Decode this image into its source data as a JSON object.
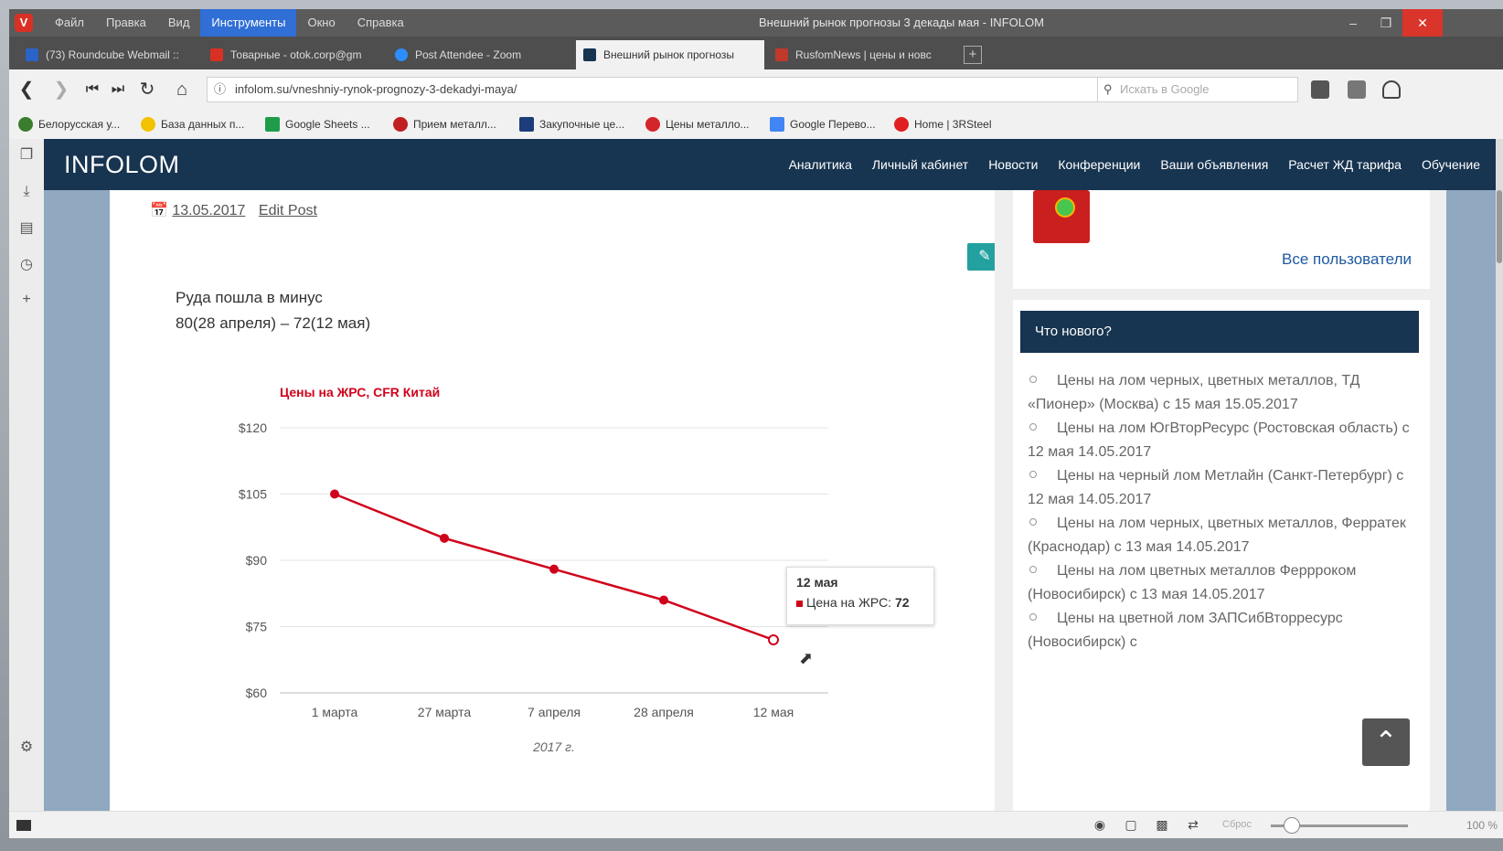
{
  "browser": {
    "menu": [
      "Файл",
      "Правка",
      "Вид",
      "Инструменты",
      "Окно",
      "Справка"
    ],
    "window_title": "Внешний рынок прогнозы 3 декады мая - INFOLOM",
    "tabs": [
      {
        "label": "(73) Roundcube Webmail ::",
        "icon_color": "#2b63c8"
      },
      {
        "label": "Товарные - otok.corp@gm",
        "icon_color": "#d93025"
      },
      {
        "label": "Post Attendee - Zoom",
        "icon_color": "#2d8cff"
      },
      {
        "label": "Внешний рынок прогнозы",
        "icon_color": "#173450"
      },
      {
        "label": "RusfomNews | цены и новс",
        "icon_color": "#c0392b"
      }
    ],
    "url": "infolom.su/vneshniy-rynok-prognozy-3-dekadyi-maya/",
    "search_placeholder": "Искать в Google",
    "bookmarks": [
      {
        "label": "Белорусская у...",
        "color": "#3a7d2c"
      },
      {
        "label": "База данных п...",
        "color": "#f2c200"
      },
      {
        "label": "Google Sheets ...",
        "color": "#1e9c4a"
      },
      {
        "label": "Прием металл...",
        "color": "#c02020"
      },
      {
        "label": "Закупочные це...",
        "color": "#1c3c7a"
      },
      {
        "label": "Цены металло...",
        "color": "#d4252a"
      },
      {
        "label": "Google Перево...",
        "color": "#4285f4"
      },
      {
        "label": "Home | 3RSteel",
        "color": "#e02020"
      }
    ],
    "zoom_label": "Сброс",
    "zoom_value": "100 %"
  },
  "site": {
    "logo": "INFOLOM",
    "nav": [
      "Аналитика",
      "Личный кабинет",
      "Новости",
      "Конференции",
      "Ваши объявления",
      "Расчет ЖД тарифа",
      "Обучение"
    ]
  },
  "post": {
    "date": "13.05.2017",
    "edit_link": "Edit Post",
    "line1": "Руда пошла в минус",
    "line2": "80(28 апреля) – 72(12 мая)"
  },
  "chart_data": {
    "type": "line",
    "title": "Цены на ЖРС, CFR Китай",
    "categories": [
      "1 марта",
      "27 марта",
      "7 апреля",
      "28 апреля",
      "12 мая"
    ],
    "series": [
      {
        "name": "Цена на ЖРС",
        "values": [
          105,
          95,
          88,
          81,
          72
        ],
        "color": "#d0021b"
      }
    ],
    "xlabel": "2017 г.",
    "ylabel": "",
    "y_ticks": [
      "$120",
      "$105",
      "$90",
      "$75",
      "$60"
    ],
    "ylim": [
      60,
      120
    ],
    "grid": true,
    "tooltip": {
      "date": "12 мая",
      "label": "Цена на ЖРС:",
      "value": "72"
    }
  },
  "sidebar": {
    "all_users": "Все пользователи",
    "news_title": "Что нового?",
    "news": [
      "Цены на лом черных, цветных металлов, ТД «Пионер» (Москва) с 15 мая 15.05.2017",
      "Цены на лом ЮгВторРесурс (Ростовская область) с 12 мая 14.05.2017",
      "Цены на черный лом Метлайн (Санкт-Петербург) с 12 мая 14.05.2017",
      "Цены на лом черных, цветных металлов, Ферратек (Краснодар) с 13 мая 14.05.2017",
      "Цены на лом цветных металлов Феррроком (Новосибирск) с 13 мая 14.05.2017",
      "Цены на цветной лом ЗАПСибВторресурс (Новосибирск) с"
    ]
  }
}
